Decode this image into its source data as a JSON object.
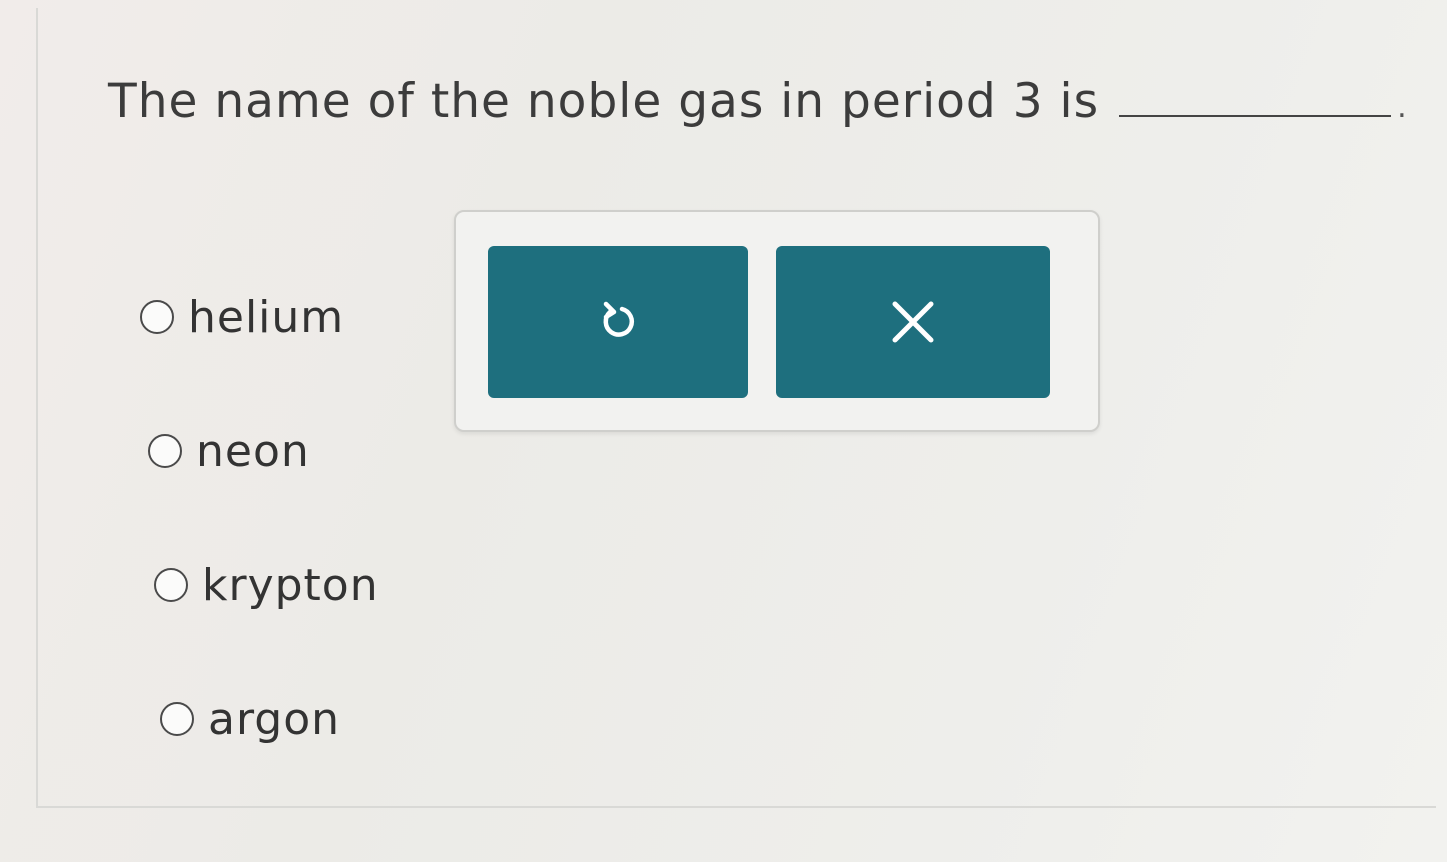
{
  "question": {
    "text": "The name of the noble gas in period 3 is",
    "end_punct": "."
  },
  "options": [
    {
      "label": "helium"
    },
    {
      "label": "neon"
    },
    {
      "label": "krypton"
    },
    {
      "label": "argon"
    }
  ],
  "toolbar": {
    "undo_icon": "undo-icon",
    "clear_icon": "close-icon"
  },
  "colors": {
    "button_bg": "#1e6f7e",
    "icon": "#ffffff"
  }
}
